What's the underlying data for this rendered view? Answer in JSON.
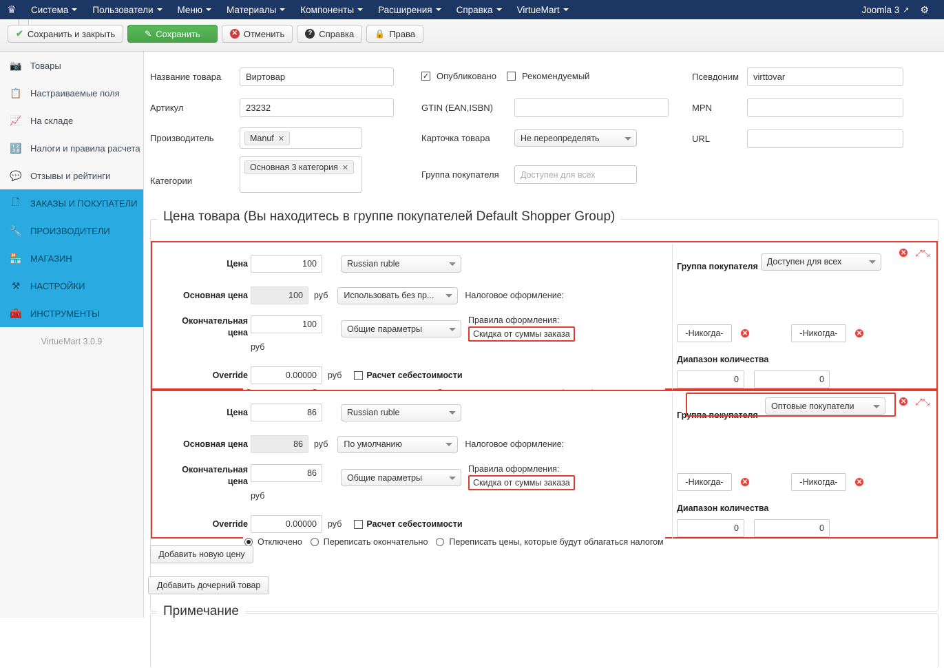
{
  "topnav": {
    "logo_icon": "joomla-logo-icon",
    "items": [
      {
        "label": "Система",
        "caret": true
      },
      {
        "label": "Пользователи",
        "caret": true
      },
      {
        "label": "Меню",
        "caret": true
      },
      {
        "label": "Материалы",
        "caret": true
      },
      {
        "label": "Компоненты",
        "caret": true
      },
      {
        "label": "Расширения",
        "caret": true
      },
      {
        "label": "Справка",
        "caret": true
      },
      {
        "label": "VirtueMart",
        "caret": true
      }
    ],
    "site_label": "Joomla 3",
    "gear_glyph": "⚙",
    "ext_glyph": "⧉",
    "bg_color": "#1c3764"
  },
  "toolbar": {
    "save_close_label": "Сохранить и закрыть",
    "save_label": "Сохранить",
    "cancel_label": "Отменить",
    "help_label": "Справка",
    "rights_label": "Права",
    "save_color": "#47a447"
  },
  "sidebar": {
    "items": [
      {
        "label": "Товары",
        "icon": "camera-icon",
        "glyph": "📷",
        "active": false
      },
      {
        "label": "Настраиваемые поля",
        "icon": "custom-fields-icon",
        "glyph": "📋",
        "active": false
      },
      {
        "label": "На складе",
        "icon": "inventory-chart-icon",
        "glyph": "📈",
        "active": false
      },
      {
        "label": "Налоги и правила расчета",
        "icon": "calculator-icon",
        "glyph": "🖩",
        "active": false
      },
      {
        "label": "Отзывы и рейтинги",
        "icon": "comments-icon",
        "glyph": "💬",
        "active": false
      },
      {
        "label": "ЗАКАЗЫ И ПОКУПАТЕЛИ",
        "icon": "orders-copy-icon",
        "glyph": "🗂",
        "active": true
      },
      {
        "label": "ПРОИЗВОДИТЕЛИ",
        "icon": "wrench-icon",
        "glyph": "🔧",
        "active": true
      },
      {
        "label": "МАГАЗИН",
        "icon": "shop-icon",
        "glyph": "🏪",
        "active": true
      },
      {
        "label": "НАСТРОЙКИ",
        "icon": "tools-icon",
        "glyph": "⚒",
        "active": true
      },
      {
        "label": "ИНСТРУМЕНТЫ",
        "icon": "toolbox-icon",
        "glyph": "🧰",
        "active": true
      }
    ],
    "version": "VirtueMart 3.0.9",
    "active_color": "#29abe2"
  },
  "product_form": {
    "name_label": "Название товара",
    "name_value": "Виртовар",
    "sku_label": "Артикул",
    "sku_value": "23232",
    "manufacturer_label": "Производитель",
    "manufacturer_tag": "Manuf",
    "categories_label": "Категории",
    "categories_tag": "Основная 3 категория",
    "published_label": "Опубликовано",
    "published_checked": true,
    "featured_label": "Рекомендуемый",
    "featured_checked": false,
    "gtin_label": "GTIN (EAN,ISBN)",
    "gtin_value": "",
    "product_card_label": "Карточка товара",
    "product_card_value": "Не переопределять",
    "shopper_group_label": "Группа покупателя",
    "shopper_group_placeholder": "Доступен для всех",
    "alias_label": "Псевдоним",
    "alias_value": "virttovar",
    "mpn_label": "MPN",
    "mpn_value": "",
    "url_label": "URL",
    "url_value": ""
  },
  "price_section": {
    "legend": "Цена товара (Вы находитесь в группе покупателей Default Shopper Group)",
    "labels": {
      "price": "Цена",
      "base_price": "Основная цена",
      "final_price": "Окончательная цена",
      "override": "Override",
      "rub": "руб",
      "cost_calc": "Расчет себестоимости",
      "tax_heading": "Налоговое оформление:",
      "rules_heading": "Правила оформления:",
      "shopper_group": "Группа покупателя",
      "qty_range": "Диапазон количества",
      "never": "-Никогда-",
      "radio_off": "Отключено",
      "radio_override_final": "Переписать окончательно",
      "radio_override_taxed": "Переписать цены, которые будут облагаться налогом"
    },
    "blocks": [
      {
        "price": "100",
        "currency": "Russian ruble",
        "base_price": "100",
        "tax_select": "Использовать без пр...",
        "final_price": "100",
        "rules_select": "Общие параметры",
        "rules_value": "Скидка от суммы заказа",
        "override": "0.00000",
        "cost_checked": false,
        "radio_selected": 0,
        "shopper_group_value": "Доступен для всех",
        "shopper_group_highlight": false,
        "date_from": "-Никогда-",
        "date_to": "-Никогда-",
        "qty_min": "0",
        "qty_max": "0"
      },
      {
        "price": "86",
        "currency": "Russian ruble",
        "base_price": "86",
        "tax_select": "По умолчанию",
        "final_price": "86",
        "rules_select": "Общие параметры",
        "rules_value": "Скидка от суммы заказа",
        "override": "0.00000",
        "cost_checked": false,
        "radio_selected": 0,
        "shopper_group_value": "Оптовые покупатели",
        "shopper_group_highlight": true,
        "date_from": "-Никогда-",
        "date_to": "-Никогда-",
        "qty_min": "0",
        "qty_max": "0"
      }
    ],
    "add_price_label": "Добавить новую цену",
    "highlight_color": "#e03b2d"
  },
  "bottom": {
    "add_child_label": "Добавить дочерний товар",
    "note_legend": "Примечание"
  }
}
